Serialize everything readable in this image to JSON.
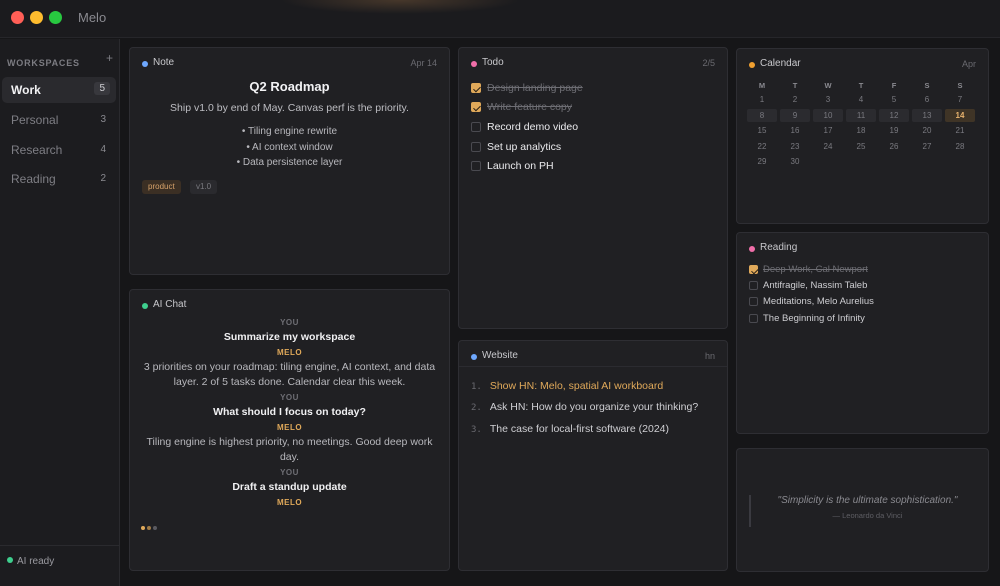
{
  "app": {
    "title": "Melo"
  },
  "sidebar": {
    "header": "WORKSPACES",
    "add_label": "+",
    "items": [
      {
        "label": "Work",
        "count": "5",
        "active": true
      },
      {
        "label": "Personal",
        "count": "3"
      },
      {
        "label": "Research",
        "count": "4"
      },
      {
        "label": "Reading",
        "count": "2"
      }
    ],
    "status": "AI ready"
  },
  "note": {
    "label": "Note",
    "date": "Apr 14",
    "dot_color": "#6ea8fe",
    "title": "Q2 Roadmap",
    "subtitle": "Ship v1.0 by end of May. Canvas perf is the priority.",
    "bullets": [
      "• Tiling engine rewrite",
      "• AI context window",
      "• Data persistence layer"
    ],
    "tags": [
      "product",
      "v1.0"
    ]
  },
  "todo": {
    "label": "Todo",
    "progress": "2/5",
    "dot_color": "#f06ea9",
    "items": [
      {
        "text": "Design landing page",
        "done": true
      },
      {
        "text": "Write feature copy",
        "done": true
      },
      {
        "text": "Record demo video",
        "done": false
      },
      {
        "text": "Set up analytics",
        "done": false
      },
      {
        "text": "Launch on PH",
        "done": false
      }
    ]
  },
  "calendar": {
    "label": "Calendar",
    "month": "Apr",
    "dot_color": "#f0a030",
    "weekdays": [
      "M",
      "T",
      "W",
      "T",
      "F",
      "S",
      "S"
    ],
    "weeks": [
      [
        "1",
        "2",
        "3",
        "4",
        "5",
        "6",
        "7"
      ],
      [
        "8",
        "9",
        "10",
        "11",
        "12",
        "13",
        "14"
      ],
      [
        "15",
        "16",
        "17",
        "18",
        "19",
        "20",
        "21"
      ],
      [
        "22",
        "23",
        "24",
        "25",
        "26",
        "27",
        "28"
      ],
      [
        "29",
        "30",
        "",
        "",
        "",
        "",
        ""
      ]
    ],
    "today": "14"
  },
  "reading": {
    "label": "Reading",
    "dot_color": "#f06ea9",
    "items": [
      {
        "text": "Deep Work, Cal Newport",
        "done": true
      },
      {
        "text": "Antifragile, Nassim Taleb",
        "done": false
      },
      {
        "text": "Meditations, Melo Aurelius",
        "done": false
      },
      {
        "text": "The Beginning of Infinity",
        "done": false
      }
    ]
  },
  "chat": {
    "label": "AI Chat",
    "dot_color": "#3ecf8e",
    "user_label": "YOU",
    "ai_label": "MELO",
    "messages": [
      {
        "user": "Summarize my workspace",
        "ai": "3 priorities on your roadmap: tiling engine, AI context, and data layer. 2 of 5 tasks done. Calendar clear this week."
      },
      {
        "user": "What should I focus on today?",
        "ai": "Tiling engine is highest priority, no meetings. Good deep work day."
      },
      {
        "user": "Draft a standup update",
        "ai": ""
      }
    ]
  },
  "website": {
    "label": "Website",
    "meta": "hn",
    "dot_color": "#6ea8fe",
    "items": [
      {
        "num": "1.",
        "text": "Show HN: Melo, spatial AI workboard",
        "highlight": true
      },
      {
        "num": "2.",
        "text": "Ask HN: How do you organize your thinking?"
      },
      {
        "num": "3.",
        "text": "The case for local-first software (2024)"
      }
    ]
  },
  "quote": {
    "text": "\"Simplicity is the ultimate sophistication.\"",
    "author": "— Leonardo da Vinci"
  },
  "colors": {
    "accent": "#e0a95a",
    "background": "#161618",
    "panel": "#202023"
  }
}
